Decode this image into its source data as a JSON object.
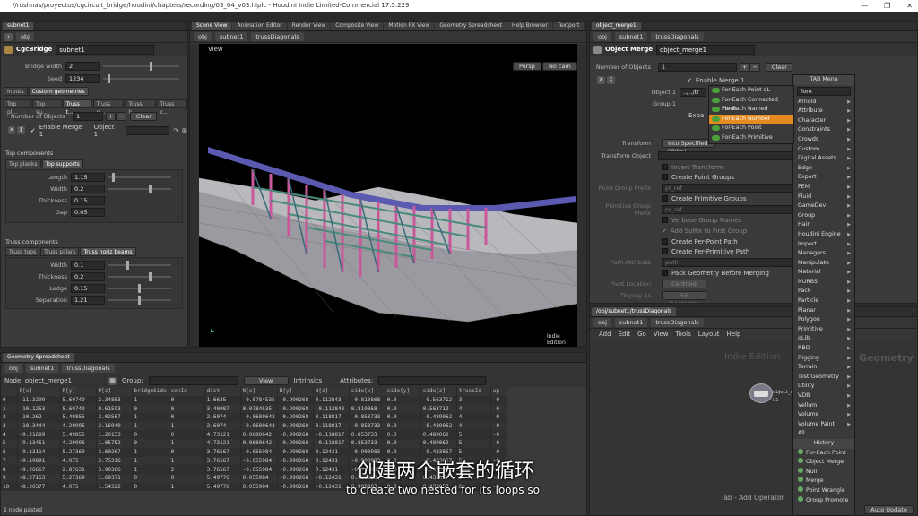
{
  "window": {
    "title": "//rushnas/proyectos/cgcircuit_bridge/houdini/chapters/recording/03_04_v03.hiplc - Houdini Indie Limited-Commercial 17.5.229"
  },
  "left_params": {
    "tab": "subnet1",
    "path": "obj",
    "node_type": "CgcBridge",
    "node_name": "subnet1",
    "bridge_width_label": "Bridge width",
    "bridge_width": "2",
    "seed_label": "Seed",
    "seed": "1234",
    "tabs": [
      "Inputs",
      "Custom geometries"
    ],
    "sub_tabs": [
      "Top pl...",
      "Top su...",
      "Truss t...",
      "Truss p...",
      "Truss h...",
      "Truss c..."
    ],
    "num_objects_label": "Number of Objects",
    "num_objects": "1",
    "clear": "Clear",
    "enable_merge": "Enable Merge 1",
    "object1": "Object 1",
    "top_components": "Top components",
    "top_tabs": [
      "Top planks",
      "Top supports"
    ],
    "top_fields": [
      {
        "label": "Length",
        "value": "1.15"
      },
      {
        "label": "Width",
        "value": "0.2"
      },
      {
        "label": "Thickness",
        "value": "0.15"
      },
      {
        "label": "Gap",
        "value": "0.05"
      }
    ],
    "truss_components": "Truss components",
    "truss_tabs": [
      "Truss tops",
      "Truss pillars",
      "Truss horiz beams"
    ],
    "truss_fields": [
      {
        "label": "Width",
        "value": "0.1"
      },
      {
        "label": "Thickness",
        "value": "0.2"
      },
      {
        "label": "Ledge",
        "value": "0.15"
      },
      {
        "label": "Separation",
        "value": "1.21"
      }
    ]
  },
  "viewport": {
    "tabs": [
      "Scene View",
      "Animation Editor",
      "Render View",
      "Composite View",
      "Motion FX View",
      "Geometry Spreadsheet",
      "Help Browser",
      "Textport"
    ],
    "path": "obj",
    "subnet": "subnet1",
    "node": "trussDiagonals",
    "label": "View",
    "persp": "Persp",
    "cam": "No cam",
    "edition": "Indie Edition"
  },
  "spreadsheet": {
    "tab": "Geometry Spreadsheet",
    "path": "obj",
    "subnet": "subnet1",
    "node": "trussDiagonals",
    "node_label": "Node: object_merge1",
    "group_label": "Group:",
    "view": "View",
    "intrinsics": "Intrinsics",
    "attributes": "Attributes:",
    "columns": [
      "",
      "P[x]",
      "P[y]",
      "P[z]",
      "bridgeSide",
      "conId",
      "dist",
      "N[x]",
      "N[y]",
      "N[z]",
      "side[x]",
      "side[y]",
      "side[z]",
      "trussId",
      "up"
    ],
    "rows": [
      [
        "0",
        "-11.3299",
        "5.69749",
        "2.34853",
        "1",
        "0",
        "1.6635",
        "-0.0784535",
        "-0.990268",
        "0.112843",
        "-0.810868",
        "0.0",
        "-0.563712",
        "3",
        "-0"
      ],
      [
        "1",
        "-10.1253",
        "5.69749",
        "0.61593",
        "0",
        "0",
        "3.40087",
        "0.0784535",
        "-0.990268",
        "-0.112843",
        "0.810868",
        "0.0",
        "0.563712",
        "4",
        "-0"
      ],
      [
        "2",
        "-10.262",
        "5.49855",
        "3.02567",
        "1",
        "0",
        "2.6074",
        "-0.0680642",
        "-0.990268",
        "0.118817",
        "-0.853733",
        "0.0",
        "-0.489062",
        "4",
        "-0"
      ],
      [
        "3",
        "-10.3444",
        "4.29995",
        "3.16949",
        "1",
        "1",
        "2.6074",
        "-0.0680642",
        "-0.990268",
        "0.118817",
        "-0.853733",
        "0.0",
        "-0.489062",
        "4",
        "-0"
      ],
      [
        "4",
        "-9.21689",
        "5.49855",
        "1.20133",
        "0",
        "0",
        "4.73121",
        "0.0680642",
        "-0.990268",
        "-0.118817",
        "0.853733",
        "0.0",
        "0.489062",
        "5",
        "-0"
      ],
      [
        "5",
        "-9.13451",
        "4.29995",
        "1.05752",
        "0",
        "1",
        "4.73121",
        "0.0680642",
        "-0.990268",
        "-0.118817",
        "0.853733",
        "0.0",
        "0.489062",
        "5",
        "-0"
      ],
      [
        "6",
        "-9.13114",
        "5.27369",
        "3.60267",
        "1",
        "0",
        "3.76567",
        "-0.055984",
        "-0.990268",
        "0.12431",
        "-0.900983",
        "0.0",
        "-0.433857",
        "5",
        "-0"
      ],
      [
        "7",
        "-9.19891",
        "4.075",
        "3.75316",
        "1",
        "1",
        "3.76567",
        "-0.055984",
        "-0.990268",
        "0.12431",
        "-0.900983",
        "0.0",
        "-0.433857",
        "5",
        "-0"
      ],
      [
        "8",
        "-9.26667",
        "2.87631",
        "3.90366",
        "1",
        "2",
        "3.76567",
        "-0.055984",
        "-0.990268",
        "0.12431",
        "-0.900983",
        "0.0",
        "-0.433857",
        "5",
        "-0"
      ],
      [
        "9",
        "-8.27153",
        "5.27369",
        "1.69371",
        "0",
        "0",
        "5.49776",
        "0.055984",
        "-0.990268",
        "-0.12431",
        "0.900983",
        "0.0",
        "0.433857",
        "6",
        "-0"
      ],
      [
        "10",
        "-8.20377",
        "4.075",
        "1.54322",
        "0",
        "1",
        "5.49776",
        "0.055984",
        "-0.990268",
        "-0.12431",
        "0.900983",
        "0.0",
        "0.433857",
        "6",
        "-0"
      ]
    ],
    "status": "1 node pasted"
  },
  "right_params": {
    "tab": "object_merge1",
    "path": "obj",
    "subnet": "subnet1",
    "node": "trussDiagonals",
    "node_type": "Object Merge",
    "node_name": "object_merge1",
    "num_objects_label": "Number of Objects",
    "num_objects": "1",
    "clear": "Clear",
    "enable_merge": "Enable Merge 1",
    "object1": "Object 1",
    "object1_value": "../../tr",
    "group1": "Group 1",
    "expand": "Expa",
    "transform_label": "Transform",
    "transform_value": "Into Specified Object",
    "transform_object": "Transform Object",
    "invert": "Invert Transform",
    "create_point_groups": "Create Point Groups",
    "point_group_prefix": "Point Group Prefix",
    "point_group_value": "pt_ref",
    "create_prim_groups": "Create Primitive Groups",
    "prim_group_prefix": "Primitive Group Prefix",
    "prim_group_value": "pr_ref",
    "verbose": "Verbose Group Names",
    "add_suffix": "Add Suffix to First Group",
    "create_per_point": "Create Per-Point Path",
    "create_per_prim": "Create Per-Primitive Path",
    "path_attr": "Path Attribute",
    "path_attr_value": "path",
    "pack": "Pack Geometry Before Merging",
    "pivot_label": "Pivot Location",
    "pivot_value": "Centroid",
    "display_label": "Display As",
    "display_value": "Full Geometry"
  },
  "network": {
    "tab": "/obj/subnet1/trussDiagonals",
    "path": "obj",
    "subnet": "subnet1",
    "node": "trussDiagonals",
    "menu": [
      "Add",
      "Edit",
      "Go",
      "View",
      "Tools",
      "Layout",
      "Help"
    ],
    "edition": "Indie Edition",
    "geometry": "Geometry",
    "node_label": "object_merge1",
    "node_label2": "L1",
    "footer": "Tab - Add Operator",
    "auto_update": "Auto Update"
  },
  "tab_menu": {
    "title": "TAB Menu",
    "search": "fore",
    "items": [
      "Arnold",
      "Attribute",
      "Character",
      "Constraints",
      "Crowds",
      "Custom",
      "Digital Assets",
      "Edge",
      "Export",
      "FEM",
      "Fluid",
      "GameDev",
      "Group",
      "Hair",
      "Houdini Engine",
      "Import",
      "Managers",
      "Manipulate",
      "Material",
      "NURBS",
      "Pack",
      "Particle",
      "Planar",
      "Polygon",
      "Primitive",
      "qLib",
      "RBD",
      "Rigging",
      "Terrain",
      "Test Geometry",
      "Utility",
      "VDB",
      "Vellum",
      "Volume",
      "Volume Paint"
    ],
    "all": "All",
    "history_title": "History",
    "history": [
      "For-Each Point",
      "Object Merge",
      "Null",
      "Merge",
      "Point Wrangle",
      "Group Promote"
    ],
    "results": [
      "For-Each Point qL",
      "For-Each Connected Piece",
      "For-Each Named Primitive",
      "For-Each Number",
      "For-Each Point",
      "For-Each Primitive"
    ],
    "selected_result": "For-Each Number"
  },
  "captions": {
    "cn": "创建两个嵌套的循环",
    "en": "to create two nested for its loops so"
  }
}
